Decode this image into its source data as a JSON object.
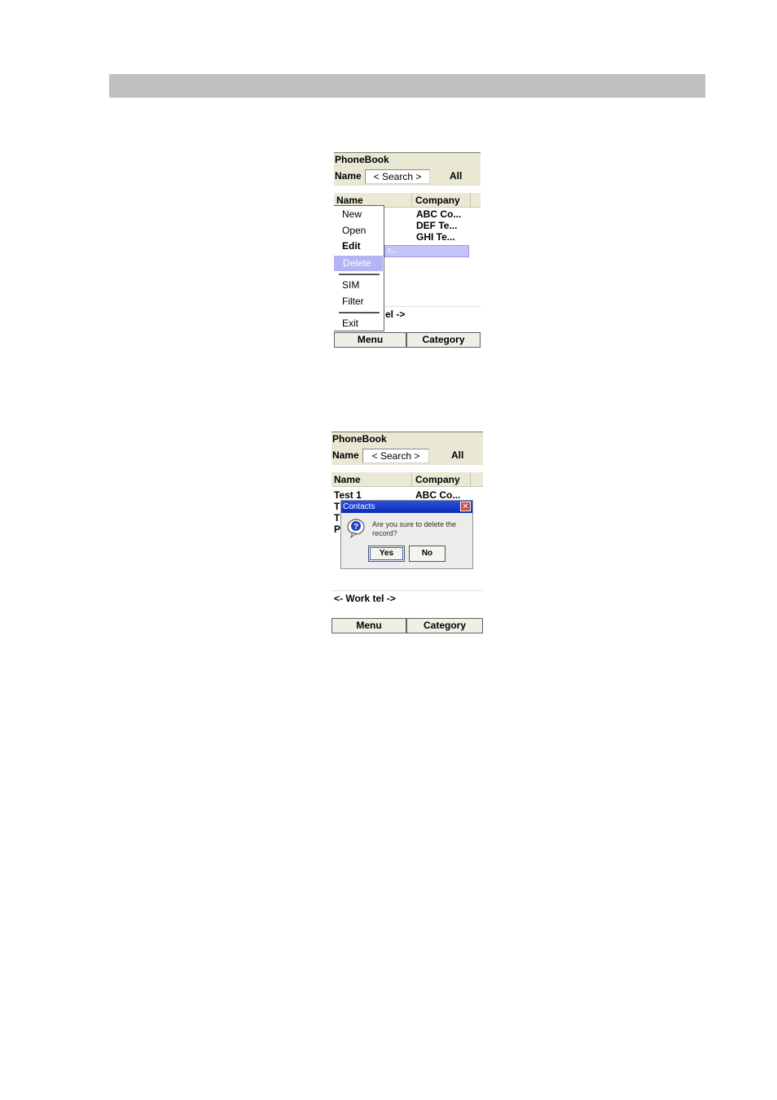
{
  "screen1": {
    "title": "PhoneBook",
    "name_label": "Name",
    "search_placeholder": "< Search >",
    "all_label": "All",
    "columns": [
      "Name",
      "Company"
    ],
    "companies": [
      "ABC Co...",
      "DEF Te...",
      "GHI Te..."
    ],
    "selected_row_fragment": "c...",
    "worktel_fragment": "el ->",
    "menu": {
      "items": [
        "New",
        "Open",
        "Edit",
        "Delete",
        "SIM",
        "Filter",
        "Exit"
      ],
      "highlighted": "Delete"
    },
    "softkeys": {
      "left": "Menu",
      "right": "Category"
    }
  },
  "screen2": {
    "title": "PhoneBook",
    "name_label": "Name",
    "search_placeholder": "< Search >",
    "all_label": "All",
    "columns": [
      "Name",
      "Company"
    ],
    "first_row": {
      "name": "Test  1",
      "company": "ABC Co..."
    },
    "hidden_row_initials": [
      "T",
      "T",
      "P"
    ],
    "worktel": "<- Work tel ->",
    "dialog": {
      "title": "Contacts",
      "message": "Are you sure to delete the record?",
      "icon": "question-icon",
      "yes": "Yes",
      "no": "No"
    },
    "softkeys": {
      "left": "Menu",
      "right": "Category"
    }
  },
  "colors": {
    "highlight": "#b4b4f4",
    "dialog_title": "#0a2bb8",
    "header_bar": "#c0c0c0"
  }
}
